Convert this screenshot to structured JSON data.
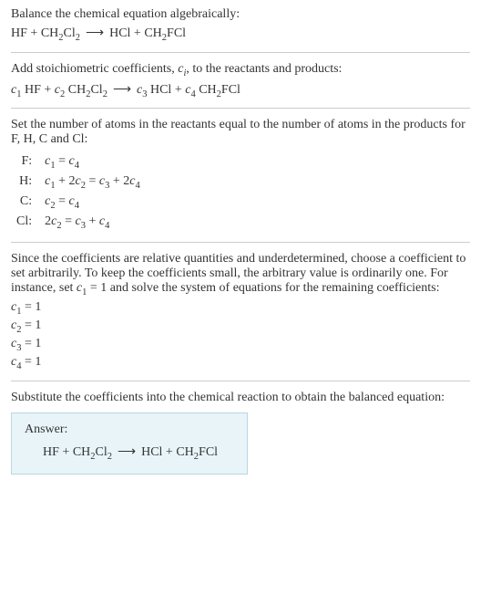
{
  "intro": {
    "line1": "Balance the chemical equation algebraically:"
  },
  "eq1": {
    "r1": "HF",
    "plus": " + ",
    "r2a": "CH",
    "r2sub": "2",
    "r2b": "Cl",
    "r2sub2": "2",
    "arrow": "⟶",
    "p1": "HCl",
    "p2a": "CH",
    "p2sub": "2",
    "p2b": "FCl"
  },
  "step2": {
    "text": "Add stoichiometric coefficients, ",
    "ci": "c",
    "ci_sub": "i",
    "text2": ", to the reactants and products:"
  },
  "eq2": {
    "c1": "c",
    "c1s": "1",
    "r1": " HF",
    "plus": " + ",
    "c2": "c",
    "c2s": "2",
    "r2a": " CH",
    "r2sub": "2",
    "r2b": "Cl",
    "r2sub2": "2",
    "arrow": "⟶",
    "c3": "c",
    "c3s": "3",
    "p1": " HCl",
    "c4": "c",
    "c4s": "4",
    "p2a": " CH",
    "p2sub": "2",
    "p2b": "FCl"
  },
  "step3": {
    "text": "Set the number of atoms in the reactants equal to the number of atoms in the products for F, H, C and Cl:"
  },
  "atoms": {
    "f_label": "F:",
    "h_label": "H:",
    "c_label": "C:",
    "cl_label": "Cl:",
    "f_eq_c1": "c",
    "f_eq_c1s": "1",
    "f_eq_mid": " = ",
    "f_eq_c4": "c",
    "f_eq_c4s": "4",
    "h_eq_c1": "c",
    "h_eq_c1s": "1",
    "h_eq_p1": " + 2",
    "h_eq_c2": "c",
    "h_eq_c2s": "2",
    "h_eq_mid": " = ",
    "h_eq_c3": "c",
    "h_eq_c3s": "3",
    "h_eq_p2": " + 2",
    "h_eq_c4": "c",
    "h_eq_c4s": "4",
    "c_eq_c2": "c",
    "c_eq_c2s": "2",
    "c_eq_mid": " = ",
    "c_eq_c4": "c",
    "c_eq_c4s": "4",
    "cl_eq_2": "2",
    "cl_eq_c2": "c",
    "cl_eq_c2s": "2",
    "cl_eq_mid": " = ",
    "cl_eq_c3": "c",
    "cl_eq_c3s": "3",
    "cl_eq_p": " + ",
    "cl_eq_c4": "c",
    "cl_eq_c4s": "4"
  },
  "step4": {
    "text1": "Since the coefficients are relative quantities and underdetermined, choose a coefficient to set arbitrarily. To keep the coefficients small, the arbitrary value is ordinarily one. For instance, set ",
    "c1": "c",
    "c1s": "1",
    "text2": " = 1 and solve the system of equations for the remaining coefficients:"
  },
  "coefs": {
    "c1l": "c",
    "c1ls": "1",
    "c1v": " = 1",
    "c2l": "c",
    "c2ls": "2",
    "c2v": " = 1",
    "c3l": "c",
    "c3ls": "3",
    "c3v": " = 1",
    "c4l": "c",
    "c4ls": "4",
    "c4v": " = 1"
  },
  "step5": {
    "text": "Substitute the coefficients into the chemical reaction to obtain the balanced equation:"
  },
  "answer": {
    "label": "Answer:",
    "r1": "HF",
    "plus": " + ",
    "r2a": "CH",
    "r2sub": "2",
    "r2b": "Cl",
    "r2sub2": "2",
    "arrow": "⟶",
    "p1": "HCl",
    "p2a": "CH",
    "p2sub": "2",
    "p2b": "FCl"
  }
}
